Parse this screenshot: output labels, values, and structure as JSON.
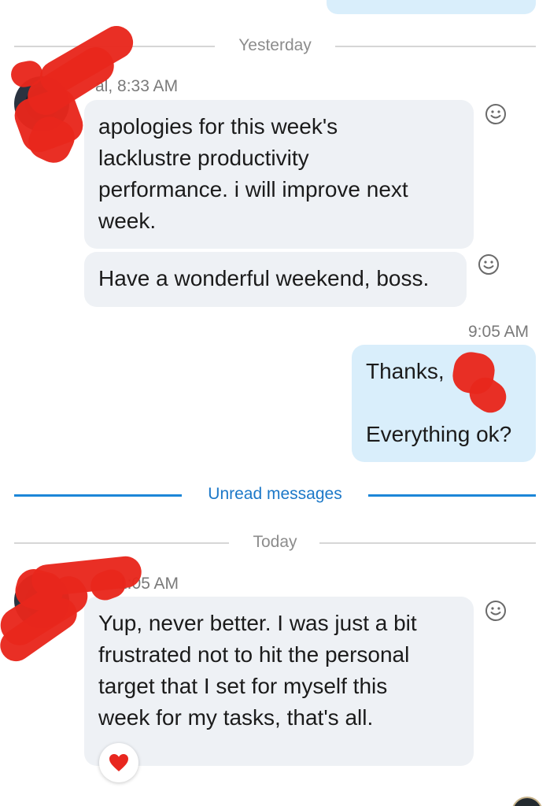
{
  "dividers": {
    "yesterday": "Yesterday",
    "unread": "Unread messages",
    "today": "Today"
  },
  "messages": [
    {
      "sender_time": "al, 8:33 AM",
      "lines": [
        "apologies for this week's",
        "lacklustre productivity",
        "performance. i will improve next",
        "week."
      ]
    },
    {
      "lines": [
        "Have a wonderful weekend, boss."
      ]
    },
    {
      "time": "9:05 AM",
      "lines": [
        "Thanks,",
        "",
        "Everything ok?"
      ]
    },
    {
      "sender_time": "1:05 AM",
      "lines": [
        "Yup, never better. I was just a bit",
        "frustrated not to hit the personal",
        "target that I set for myself this",
        "week for my tasks, that's all."
      ]
    }
  ],
  "icons": {
    "reaction": "smiley-face-icon",
    "heart": "heart-icon"
  },
  "colors": {
    "incoming_bubble": "#eef1f5",
    "outgoing_bubble": "#d9eefb",
    "unread_accent": "#1c86d8",
    "heart": "#e8271f",
    "redaction": "#e8261c"
  }
}
